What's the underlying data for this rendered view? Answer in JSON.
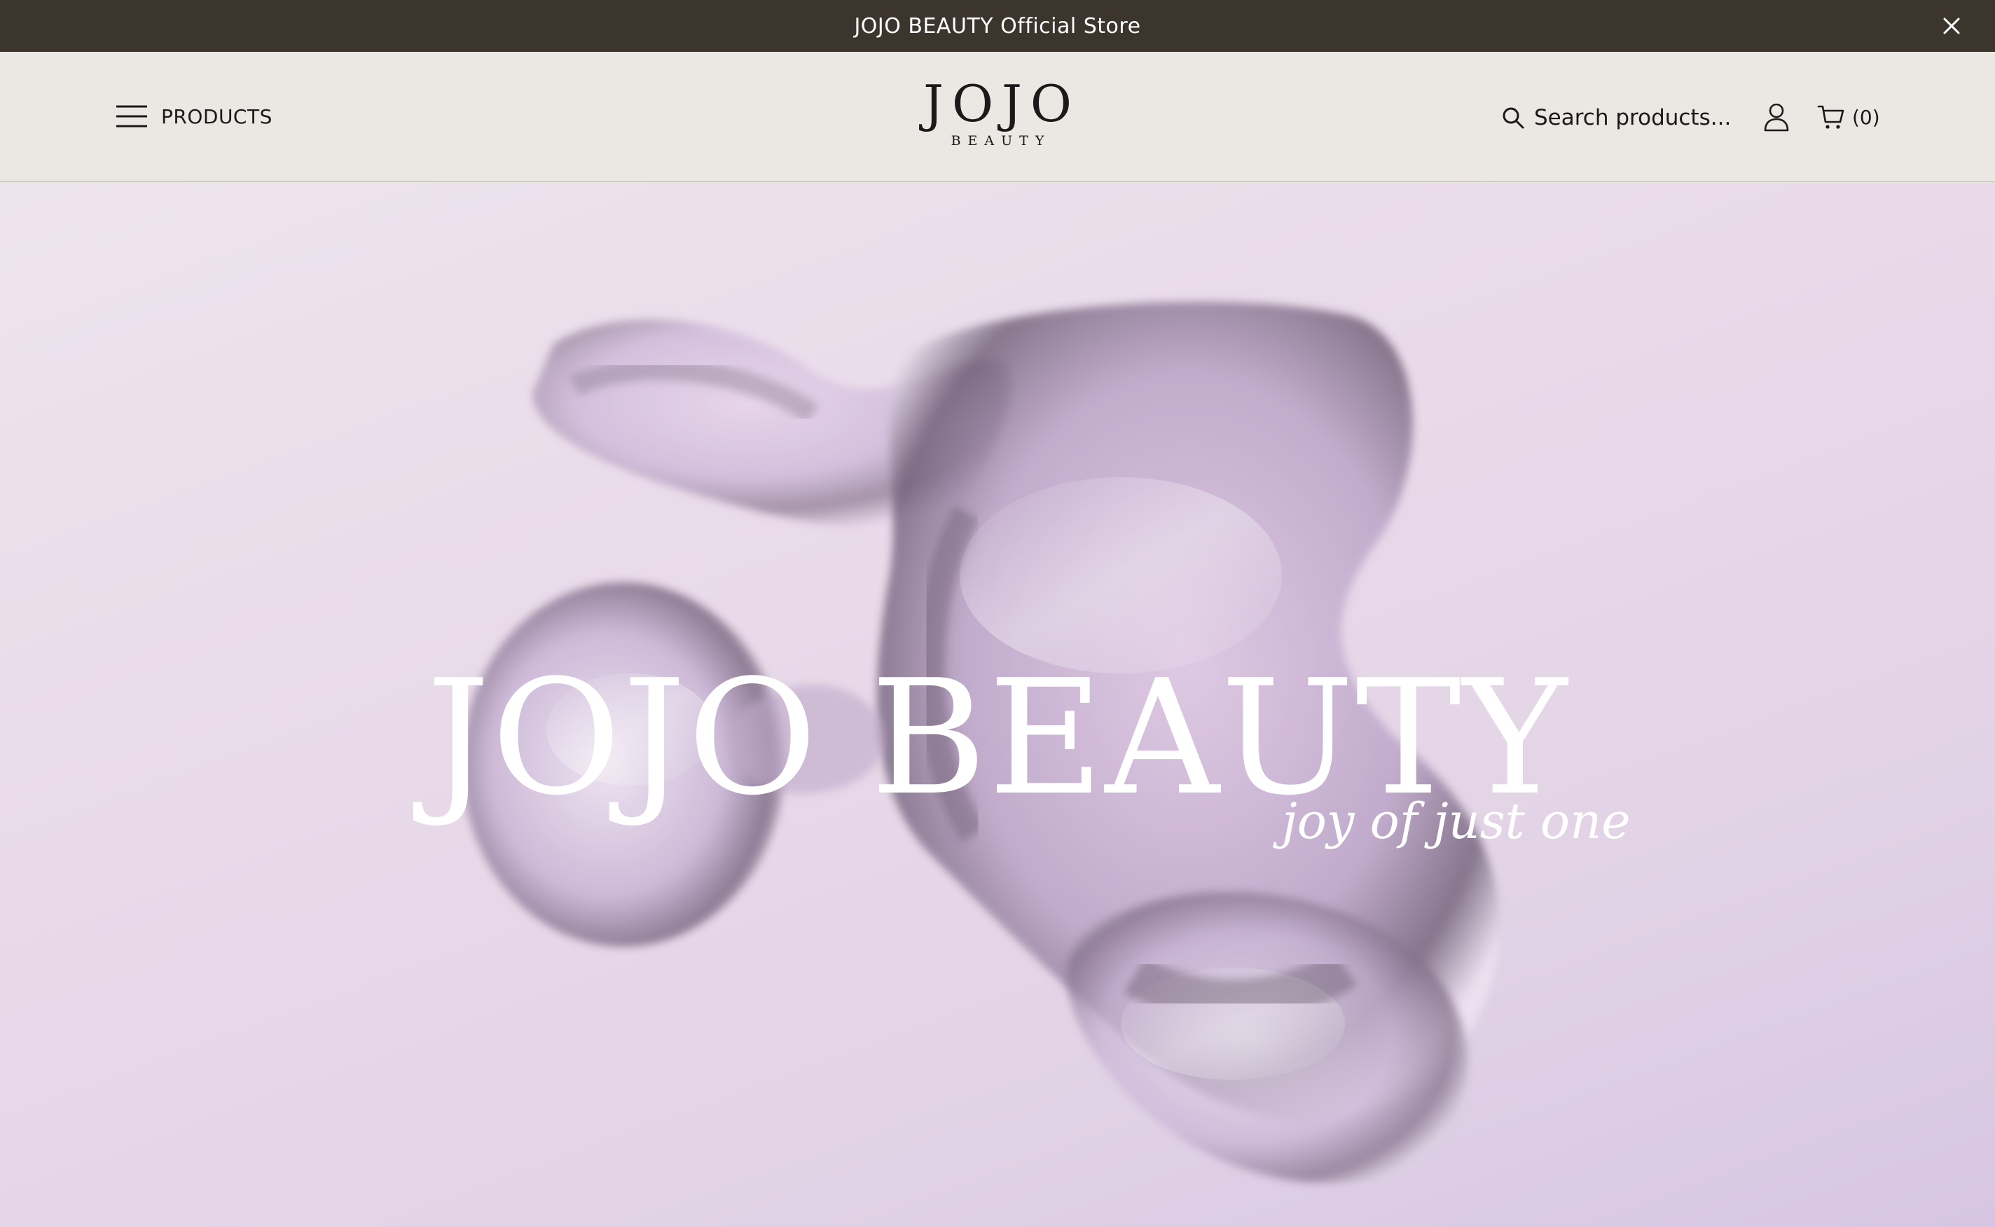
{
  "announcement": {
    "text": "JOJO BEAUTY Official Store",
    "close_icon": "close-icon"
  },
  "header": {
    "menu_label": "PRODUCTS",
    "menu_icon": "hamburger-menu-icon",
    "logo": {
      "main": "JOJO",
      "sub": "BEAUTY"
    },
    "search_placeholder": "Search products...",
    "search_icon": "search-icon",
    "account_icon": "user-icon",
    "cart_icon": "cart-icon",
    "cart_count": "(0)"
  },
  "hero": {
    "title": "JOJO BEAUTY",
    "tagline": "joy of just one"
  },
  "colors": {
    "announcement_bg": "#3c352d",
    "header_bg": "#ebe8e4",
    "hero_bg": "#e8dae9",
    "text_dark": "#1a1a1a",
    "hero_text": "#ffffff"
  }
}
